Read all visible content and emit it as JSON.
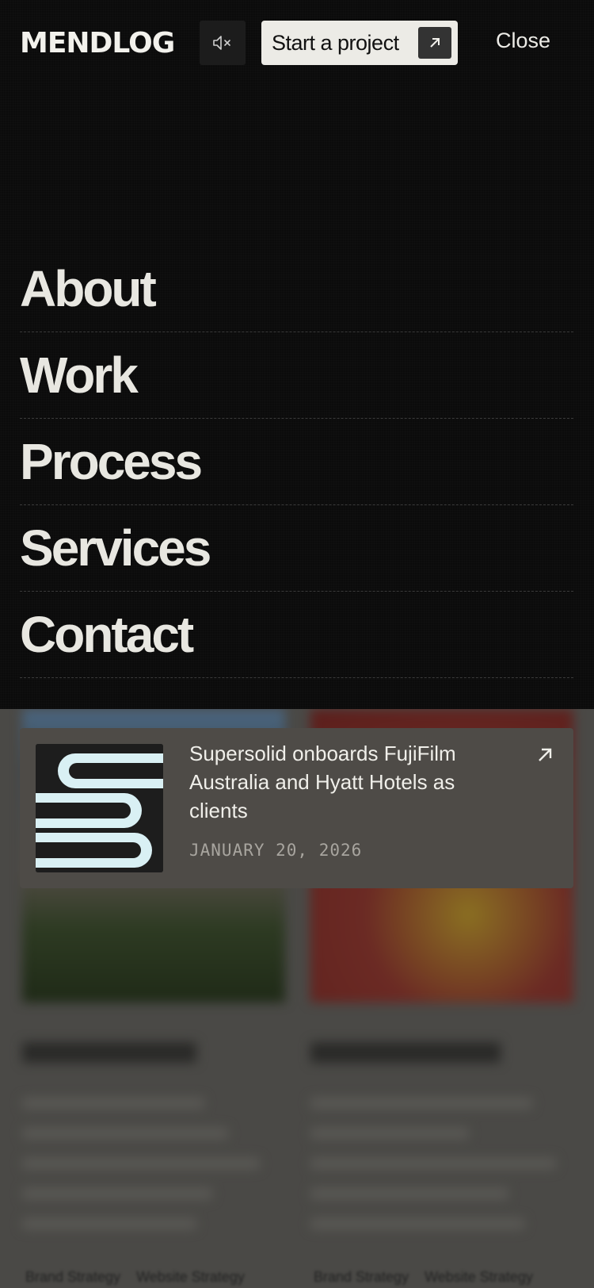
{
  "header": {
    "logo": "MENDLOG",
    "sound_icon": "speaker-muted-icon",
    "start_label": "Start a project",
    "start_icon": "arrow-up-right-icon",
    "close_label": "Close"
  },
  "nav": {
    "items": [
      {
        "label": "About"
      },
      {
        "label": "Work"
      },
      {
        "label": "Process"
      },
      {
        "label": "Services"
      },
      {
        "label": "Contact"
      }
    ]
  },
  "news": {
    "title": "Supersolid onboards FujiFilm Australia and Hyatt Hotels as clients",
    "date": "JANUARY 20, 2026",
    "arrow_icon": "arrow-up-right-icon"
  },
  "background": {
    "cards": [
      {
        "tags": [
          "Brand Strategy",
          "Website Strategy"
        ]
      },
      {
        "tags": [
          "Brand Strategy",
          "Website Strategy"
        ]
      }
    ]
  },
  "colors": {
    "menu_bg": "#0b0b0b",
    "text_light": "#ecebe6",
    "card_bg": "#4e4b47",
    "thumb_stripes": "#d9f0f4"
  }
}
